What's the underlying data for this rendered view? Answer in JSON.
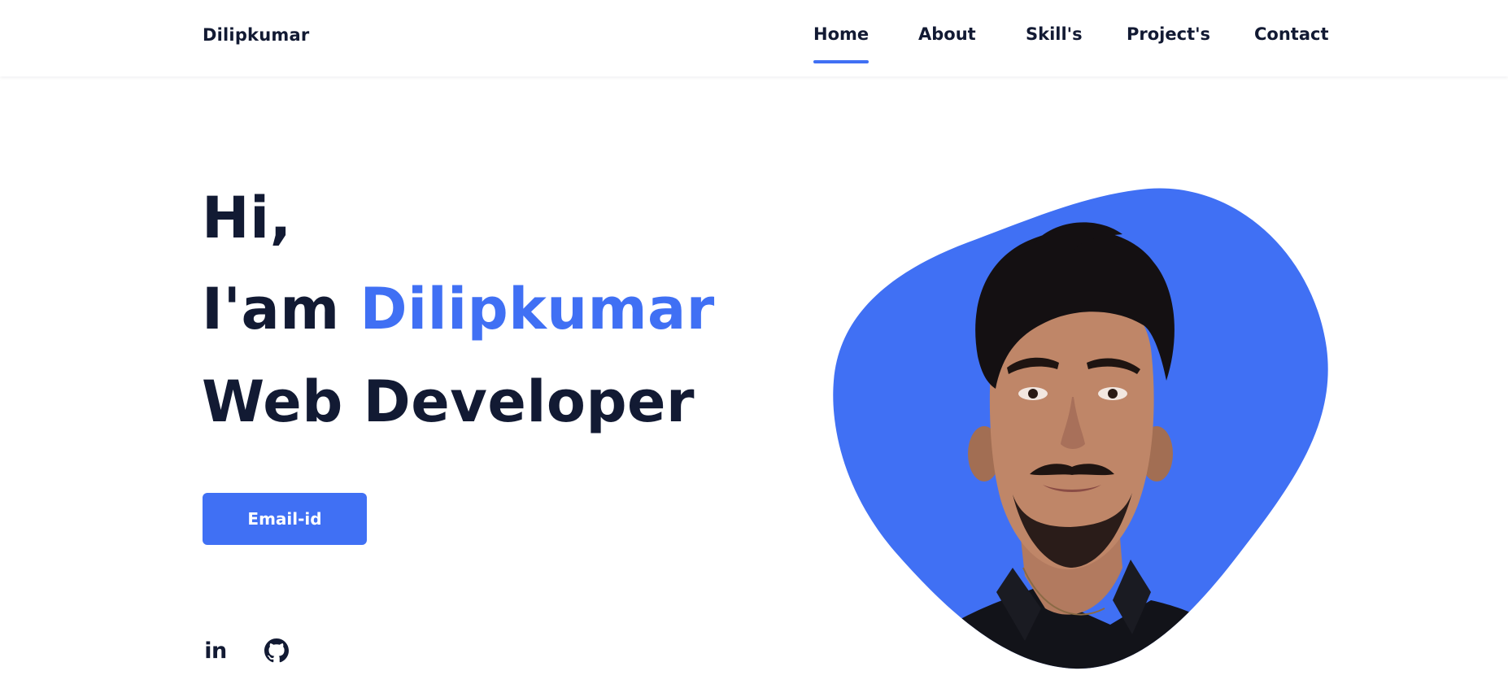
{
  "header": {
    "logo": "Dilipkumar",
    "nav": [
      {
        "label": "Home",
        "active": true
      },
      {
        "label": "About",
        "active": false
      },
      {
        "label": "Skill's",
        "active": false
      },
      {
        "label": "Project's",
        "active": false
      },
      {
        "label": "Contact",
        "active": false
      }
    ]
  },
  "hero": {
    "line1": "Hi,",
    "line2_prefix": "I'am",
    "name": "Dilipkumar",
    "role": "Web Developer",
    "button_label": "Email-id"
  },
  "social": {
    "linkedin_icon": "linkedin-icon",
    "github_icon": "github-icon"
  },
  "colors": {
    "accent": "#4070f4",
    "text_dark": "#121a33",
    "background": "#ffffff"
  }
}
